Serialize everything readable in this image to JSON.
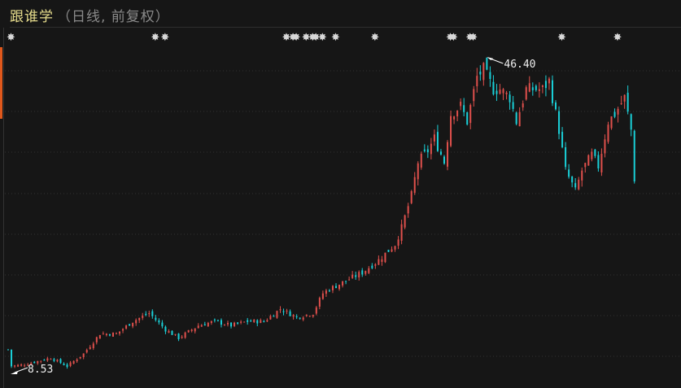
{
  "header": {
    "stock_name": "跟谁学",
    "period_label": "（日线, 前复权）"
  },
  "colors": {
    "up": "#e0504c",
    "down": "#1ad0d8",
    "grid": "#333333",
    "marker": "#d8d8d8",
    "title": "#e6dc8c"
  },
  "chart_data": {
    "type": "candlestick",
    "title": "跟谁学 (日线, 前复权)",
    "bars": 192,
    "price_range": [
      8.53,
      46.4
    ],
    "annotations": {
      "max": {
        "label": "46.40",
        "bar": 146
      },
      "min": {
        "label": "8.53",
        "bar": 2
      }
    },
    "close_waypoints": [
      [
        0,
        11.3
      ],
      [
        1,
        9.3
      ],
      [
        5,
        9.5
      ],
      [
        13,
        10.3
      ],
      [
        18,
        9.3
      ],
      [
        23,
        10.8
      ],
      [
        28,
        13.2
      ],
      [
        33,
        13.2
      ],
      [
        38,
        14.7
      ],
      [
        43,
        15.7
      ],
      [
        48,
        13.7
      ],
      [
        52,
        12.7
      ],
      [
        58,
        14.2
      ],
      [
        63,
        14.7
      ],
      [
        68,
        14.2
      ],
      [
        73,
        14.7
      ],
      [
        78,
        14.7
      ],
      [
        83,
        16.2
      ],
      [
        88,
        15.2
      ],
      [
        93,
        15.7
      ],
      [
        96,
        18.1
      ],
      [
        98,
        18.6
      ],
      [
        103,
        19.6
      ],
      [
        108,
        20.6
      ],
      [
        113,
        22.1
      ],
      [
        118,
        24.0
      ],
      [
        120,
        26.0
      ],
      [
        123,
        29.9
      ],
      [
        125,
        33.9
      ],
      [
        128,
        35.3
      ],
      [
        130,
        36.8
      ],
      [
        133,
        33.9
      ],
      [
        135,
        39.7
      ],
      [
        138,
        40.7
      ],
      [
        140,
        38.8
      ],
      [
        143,
        44.2
      ],
      [
        145,
        45.1
      ],
      [
        148,
        42.7
      ],
      [
        150,
        42.7
      ],
      [
        153,
        41.7
      ],
      [
        155,
        38.8
      ],
      [
        158,
        42.7
      ],
      [
        163,
        42.7
      ],
      [
        165,
        43.7
      ],
      [
        168,
        37.8
      ],
      [
        170,
        32.9
      ],
      [
        173,
        30.4
      ],
      [
        175,
        32.9
      ],
      [
        178,
        34.8
      ],
      [
        180,
        33.4
      ],
      [
        183,
        38.8
      ],
      [
        185,
        39.7
      ],
      [
        188,
        41.7
      ],
      [
        190,
        37.8
      ],
      [
        191,
        31.9
      ]
    ],
    "event_marker_bars": [
      0,
      44,
      47,
      84,
      86,
      87,
      90,
      92,
      93,
      95,
      99,
      111,
      134,
      135,
      140,
      141,
      168,
      185
    ]
  }
}
